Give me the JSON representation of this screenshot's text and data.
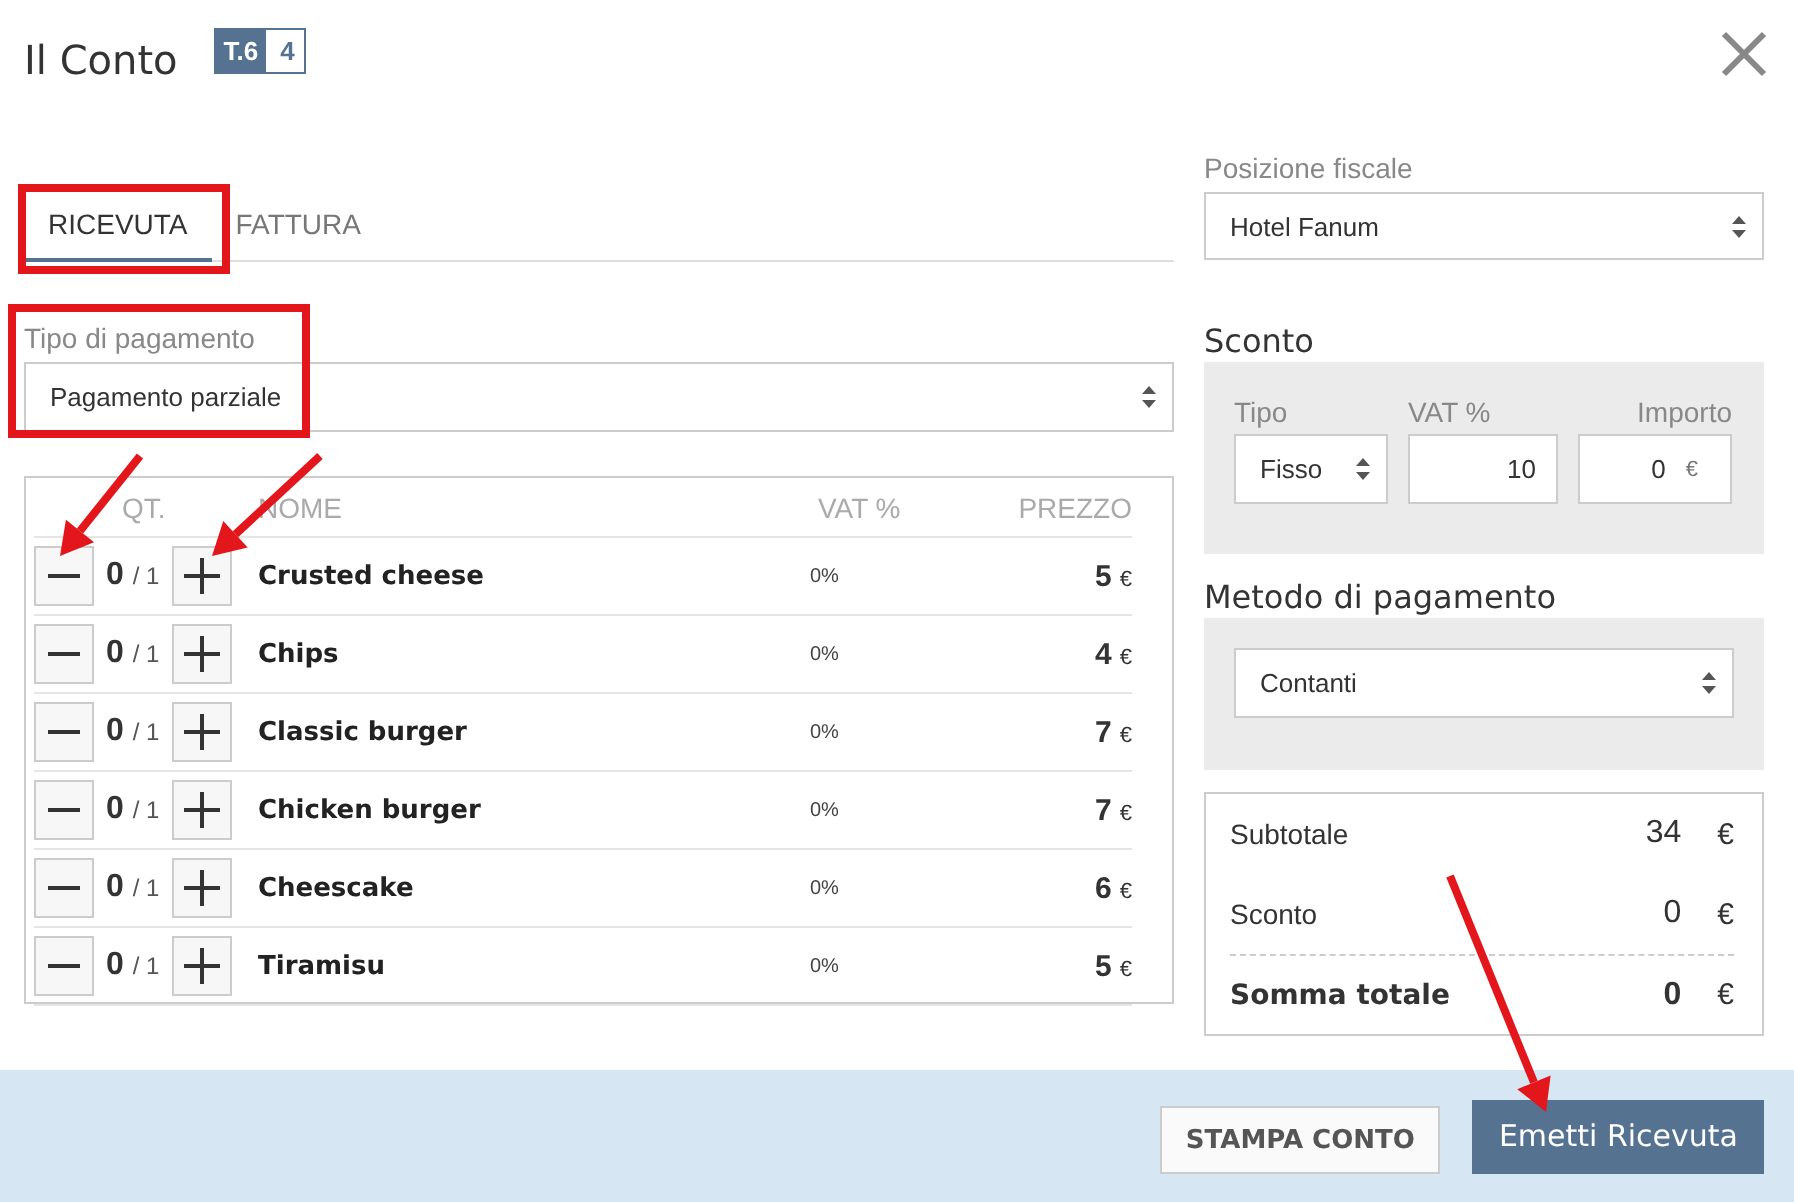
{
  "dialog": {
    "title": "Il Conto",
    "badge": {
      "table": "T.6",
      "guests": "4"
    }
  },
  "tabs": [
    {
      "label": "RICEVUTA",
      "selected": true,
      "highlighted": true
    },
    {
      "label": "FATTURA",
      "selected": false,
      "highlighted": false
    }
  ],
  "payment_type": {
    "label": "Tipo di pagamento",
    "value": "Pagamento parziale",
    "highlighted": true
  },
  "items": {
    "columns": [
      "QT.",
      "NOME",
      "VAT %",
      "PREZZO"
    ],
    "rows": [
      {
        "qty": "0",
        "max": "/ 1",
        "name": "Crusted cheese",
        "vat": "0%",
        "price": "5",
        "currency": "€",
        "arrows": true
      },
      {
        "qty": "0",
        "max": "/ 1",
        "name": "Chips",
        "vat": "0%",
        "price": "4",
        "currency": "€",
        "arrows": false
      },
      {
        "qty": "0",
        "max": "/ 1",
        "name": "Classic burger",
        "vat": "0%",
        "price": "7",
        "currency": "€",
        "arrows": false
      },
      {
        "qty": "0",
        "max": "/ 1",
        "name": "Chicken burger",
        "vat": "0%",
        "price": "7",
        "currency": "€",
        "arrows": false
      },
      {
        "qty": "0",
        "max": "/ 1",
        "name": "Cheescake",
        "vat": "0%",
        "price": "6",
        "currency": "€",
        "arrows": false
      },
      {
        "qty": "0",
        "max": "/ 1",
        "name": "Tiramisu",
        "vat": "0%",
        "price": "5",
        "currency": "€",
        "arrows": false
      }
    ]
  },
  "fiscal_position": {
    "label": "Posizione fiscale",
    "value": "Hotel Fanum"
  },
  "discount": {
    "title": "Sconto",
    "type_label": "Tipo",
    "type_value": "Fisso",
    "vat_label": "VAT %",
    "vat_value": "10",
    "amount_label": "Importo",
    "amount_value": "0",
    "amount_currency": "€"
  },
  "payment_method": {
    "title": "Metodo di pagamento",
    "value": "Contanti"
  },
  "totals": [
    {
      "label": "Subtotale",
      "value": "34",
      "currency": "€",
      "kind": "plain"
    },
    {
      "label": "Sconto",
      "value": "0",
      "currency": "€",
      "kind": "plain"
    },
    {
      "label": "Somma totale",
      "value": "0",
      "currency": "€",
      "kind": "total"
    }
  ],
  "buttons": [
    {
      "label": "STAMPA CONTO",
      "kind": "secondary",
      "arrow": false
    },
    {
      "label": "Emetti Ricevuta",
      "kind": "primary",
      "arrow": true
    }
  ]
}
